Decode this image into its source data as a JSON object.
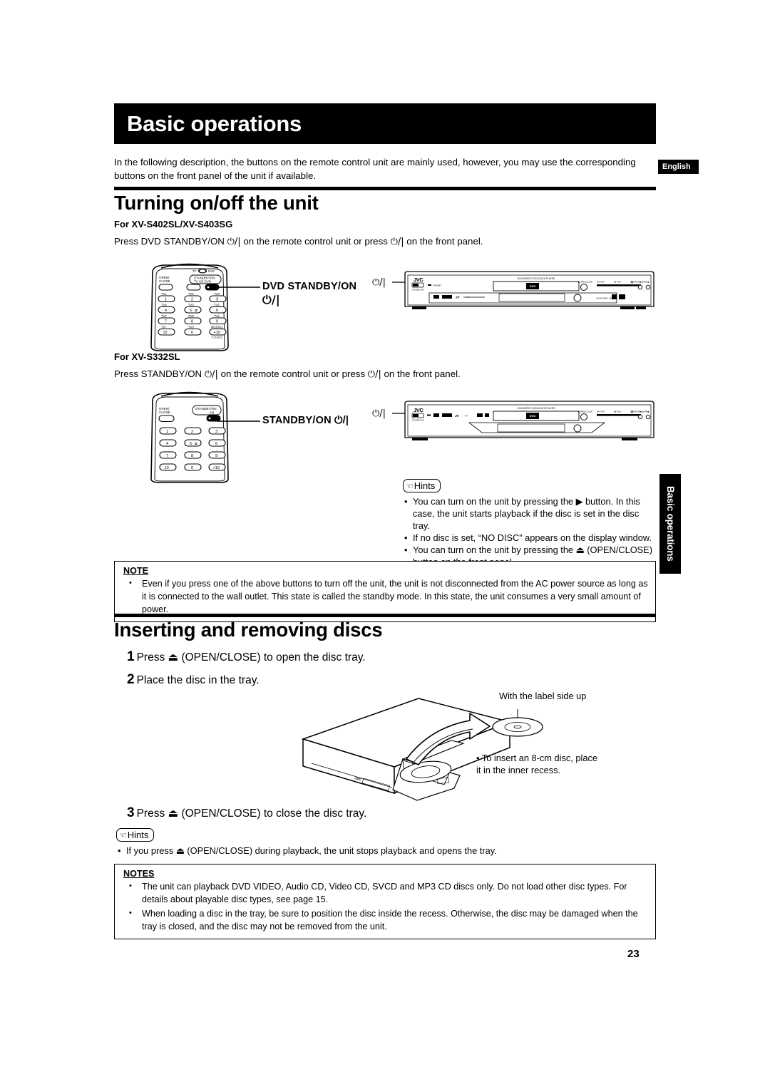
{
  "page": {
    "number": "23",
    "language_tab": "English",
    "side_tab": "Basic operations"
  },
  "chapter": {
    "title": "Basic operations"
  },
  "intro": "In the following description, the buttons on the remote control unit are mainly used, however, you may use the corresponding buttons on the front panel of the unit if available.",
  "section1": {
    "heading": "Turning on/off the unit",
    "sub1": {
      "label": "For XV-S402SL/XV-S403SG",
      "text_a": "Press DVD STANDBY/ON ",
      "text_b": " on the remote control unit or press ",
      "text_c": " on the front panel.",
      "callout_line1": "DVD STANDBY/ON",
      "callout_line2": "⏻/|"
    },
    "sub2": {
      "label": "For XV-S332SL",
      "text_a": "Press STANDBY/ON ",
      "text_b": " on the remote control unit or press ",
      "text_c": " on the front panel.",
      "callout": "STANDBY/ON ⏻/|"
    },
    "hints": {
      "label": "Hints",
      "items": [
        "You can turn on the unit by pressing the ▶ button. In this case, the unit starts playback if the disc is set in the disc tray.",
        "If no disc is set, “NO DISC” appears on the display window.",
        "You can turn on the unit by pressing the ⏏ (OPEN/CLOSE) button on the front panel."
      ]
    },
    "note": {
      "title": "NOTE",
      "items": [
        "Even if you press one of the above buttons to turn off the unit, the unit is not disconnected from the AC power source as long as it is connected to the wall outlet. This state is called the standby mode.  In this state, the unit consumes a very small amount of power."
      ]
    }
  },
  "section2": {
    "heading": "Inserting and removing discs",
    "steps": [
      {
        "num": "1",
        "text": "Press ⏏ (OPEN/CLOSE) to open the disc tray."
      },
      {
        "num": "2",
        "text": "Place the disc in the tray."
      },
      {
        "num": "3",
        "text": "Press ⏏ (OPEN/CLOSE) to close the disc tray."
      }
    ],
    "figure": {
      "label_top": "With the label side up",
      "note_8cm": "• To insert an 8-cm disc, place\n  it in the inner recess."
    },
    "hints": {
      "label": "Hints",
      "items": [
        "If you press ⏏ (OPEN/CLOSE) during playback, the unit stops playback and opens the tray."
      ]
    },
    "notes": {
      "title": "NOTES",
      "items": [
        "The unit can playback DVD VIDEO, Audio CD, Video CD, SVCD and MP3 CD discs only.  Do not load other disc types. For details about playable disc types, see page 15.",
        "When loading a disc in the tray, be sure to position the disc inside the recess. Otherwise, the disc may be damaged when the tray is closed, and the disc may not be removed from the unit."
      ]
    }
  },
  "remote1": {
    "top_marks": [
      "TV",
      "DVD"
    ],
    "open_close": "OPEN/\nCLOSE",
    "standby_block": [
      "STANDBY/ON",
      "TV  ⏻/|  DVD"
    ],
    "keys": [
      {
        "top": "TV1",
        "main": "1"
      },
      {
        "top": "TV2",
        "main": "2"
      },
      {
        "top": "TV3",
        "main": "3"
      },
      {
        "top": "TV4",
        "main": "4"
      },
      {
        "top": "TV5",
        "main": "5"
      },
      {
        "top": "TV6",
        "main": "6"
      },
      {
        "top": "TV7",
        "main": "7"
      },
      {
        "top": "TV8",
        "main": "8"
      },
      {
        "top": "TV9",
        "main": "9"
      },
      {
        "top": "TV+",
        "main": "10"
      },
      {
        "top": "TV0",
        "main": "0"
      },
      {
        "top": "MUTING",
        "main": "+10"
      }
    ],
    "bottom_hint": "TUNING"
  },
  "remote2": {
    "open_close": "OPEN/\nCLOSE",
    "standby_block": [
      "STANDBY/ON",
      "⏻/|"
    ],
    "keys": [
      {
        "main": "1"
      },
      {
        "main": "2"
      },
      {
        "main": "3"
      },
      {
        "main": "4"
      },
      {
        "main": "5"
      },
      {
        "main": "6"
      },
      {
        "main": "7"
      },
      {
        "main": "8"
      },
      {
        "main": "9"
      },
      {
        "main": "10"
      },
      {
        "main": "0"
      },
      {
        "main": "+10"
      }
    ]
  },
  "front_panel": {
    "brand": "JVC",
    "model_text": "DVD/SUPER VCD/VCD/CD PLAYER",
    "disc_logo": "DVD",
    "power_symbol": "⏻/|",
    "buttons": [
      "OPEN/CLOSE",
      "STOP",
      "PLAY",
      "PAUSE",
      "SKIP"
    ],
    "jog_label": "JOG/COMPU LINK"
  }
}
